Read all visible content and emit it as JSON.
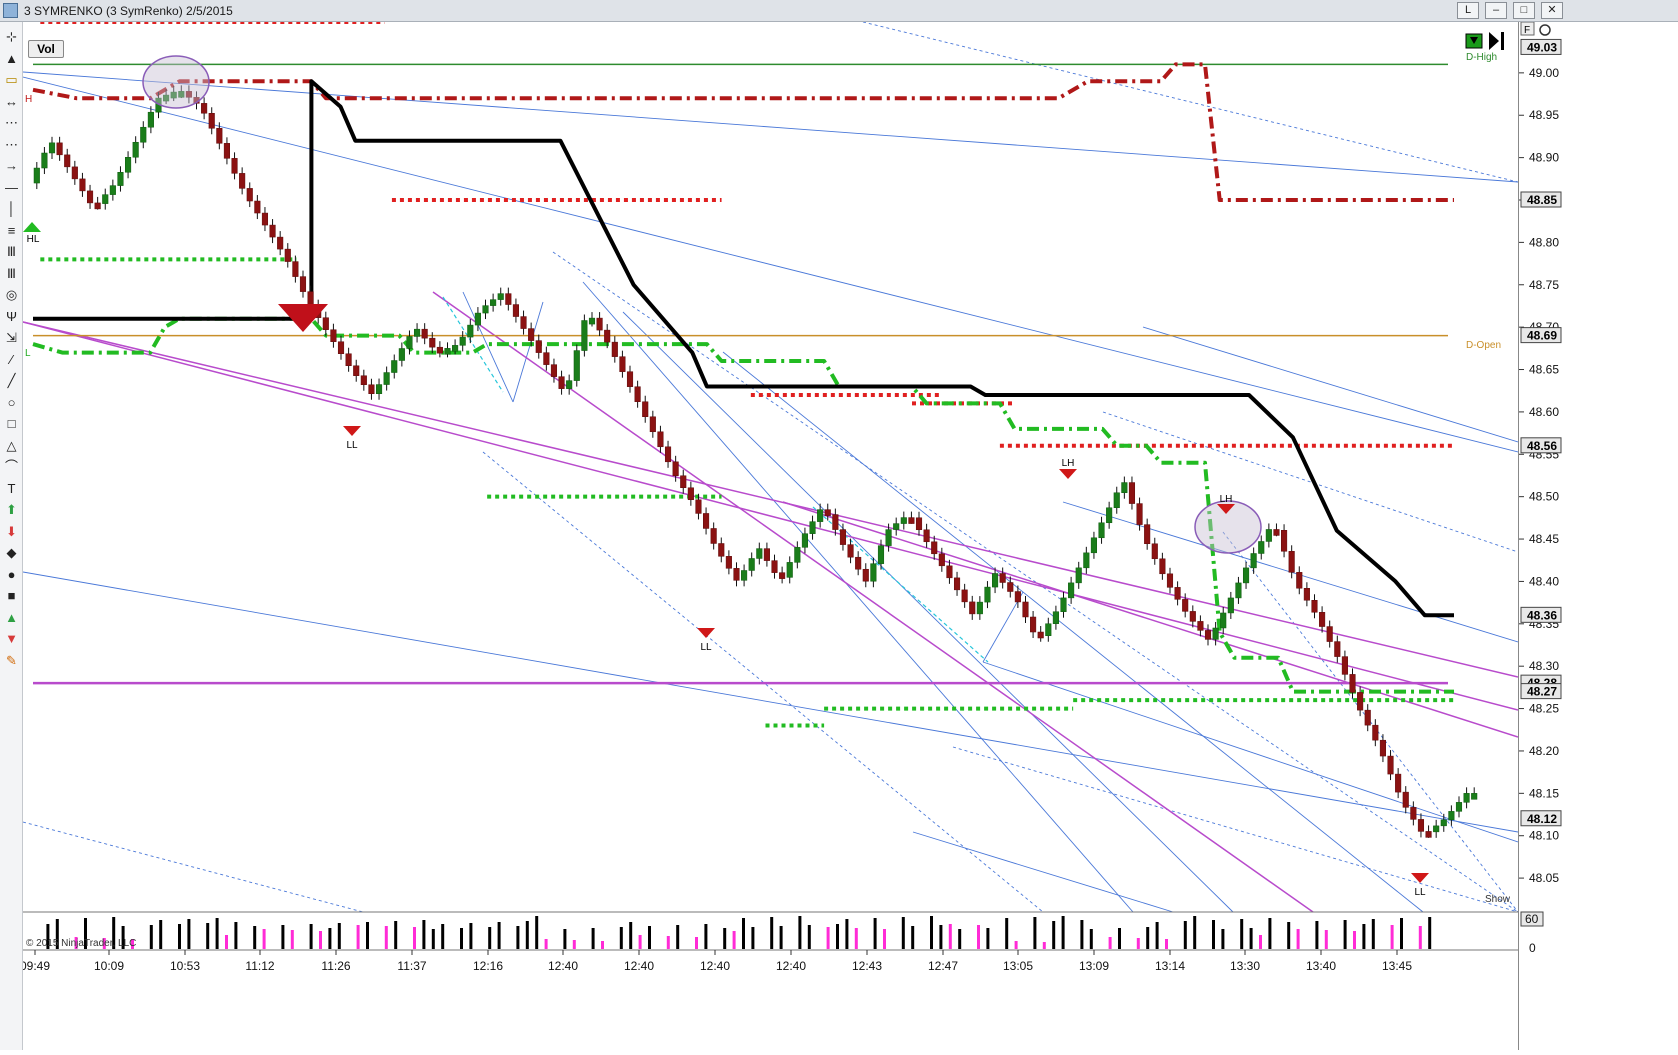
{
  "window": {
    "title": "3 SYMRENKO (3 SymRenko)  2/5/2015",
    "buttons": [
      "L",
      "–",
      "□",
      "✕"
    ],
    "accent": "#dfe3e8"
  },
  "indicator_tag": "Vol",
  "markers": {
    "d_high": "D-High",
    "d_open": "D-Open",
    "show": "Show",
    "hl": "HL",
    "h": "H",
    "l": "L",
    "ll1": "LL",
    "ll2": "LL",
    "ll3": "LL",
    "lh1": "LH",
    "lh2": "LH",
    "copyright": "© 2015 NinjaTrader, LLC"
  },
  "price_tags": [
    {
      "label": "49.03",
      "color": "#ffffff",
      "text": "#000000"
    },
    {
      "label": "48.85",
      "color": "#ffffff",
      "text": "#000000"
    },
    {
      "label": "48.69",
      "color": "#ffffff",
      "text": "#000000"
    },
    {
      "label": "48.56",
      "color": "#ffffff",
      "text": "#000000"
    },
    {
      "label": "48.36",
      "color": "#ffffff",
      "text": "#000000"
    },
    {
      "label": "48.28",
      "color": "#ffffff",
      "text": "#000000"
    },
    {
      "label": "48.27",
      "color": "#ffffff",
      "text": "#000000"
    },
    {
      "label": "48.12",
      "color": "#ffffff",
      "text": "#000000"
    }
  ],
  "volume_axis": {
    "ticks": [
      "60",
      "0"
    ]
  },
  "toolbar_icons": [
    "crosshair-icon",
    "arrow-up-icon",
    "rect-icon",
    "arrow-line-icon",
    "dots-line-icon",
    "dots-line2-icon",
    "arrow-right-icon",
    "hline-icon",
    "vline-icon",
    "channel-icon",
    "fib-icon",
    "fib2-icon",
    "target-icon",
    "pitchfork-icon",
    "regression-icon",
    "ray-icon",
    "line-icon",
    "circle-icon",
    "square-icon",
    "triangle-icon",
    "arc-icon",
    "text-icon",
    "up-arrow-icon",
    "down-arrow-icon",
    "diamond-icon",
    "dot-icon",
    "stop-icon",
    "triangle-up-icon",
    "triangle-down-icon",
    "pencil-icon"
  ],
  "chart_data": {
    "type": "candlestick",
    "title": "3 SYMRENKO (3 SymRenko)  2/5/2015",
    "y_range": [
      48.01,
      49.06
    ],
    "y_ticks": [
      49.0,
      48.95,
      48.9,
      48.85,
      48.8,
      48.75,
      48.7,
      48.65,
      48.6,
      48.55,
      48.5,
      48.45,
      48.4,
      48.35,
      48.3,
      48.25,
      48.2,
      48.15,
      48.1,
      48.05
    ],
    "x_tick_labels": [
      "09:49",
      "10:09",
      "10:53",
      "11:12",
      "11:26",
      "11:37",
      "12:16",
      "12:40",
      "12:40",
      "12:40",
      "12:40",
      "12:43",
      "12:47",
      "13:05",
      "13:09",
      "13:14",
      "13:30",
      "13:40",
      "13:45"
    ],
    "price_path": [
      48.87,
      48.92,
      48.88,
      48.84,
      48.87,
      48.92,
      48.97,
      48.98,
      48.96,
      48.91,
      48.86,
      48.82,
      48.78,
      48.73,
      48.69,
      48.65,
      48.62,
      48.66,
      48.7,
      48.67,
      48.68,
      48.72,
      48.74,
      48.7,
      48.66,
      48.62,
      48.72,
      48.68,
      48.63,
      48.58,
      48.53,
      48.49,
      48.44,
      48.4,
      48.44,
      48.4,
      48.45,
      48.49,
      48.44,
      48.4,
      48.46,
      48.48,
      48.44,
      48.4,
      48.36,
      48.41,
      48.38,
      48.33,
      48.37,
      48.42,
      48.47,
      48.52,
      48.45,
      48.4,
      48.36,
      48.33,
      48.38,
      48.43,
      48.47,
      48.4,
      48.36,
      48.31,
      48.25,
      48.2,
      48.14,
      48.1,
      48.12,
      48.15
    ],
    "volume_bars_magenta_fraction": 0.3,
    "series": [
      {
        "name": "",
        "type": "hline",
        "value": 49.01,
        "color": "#2e8b2e"
      },
      {
        "name": "",
        "type": "hline",
        "value": 48.69,
        "color": "#c98f2a"
      },
      {
        "name": "",
        "type": "hline",
        "value": 48.28,
        "color": "#b84bcc"
      }
    ],
    "stop_line_black": [
      [
        0.0,
        48.71
      ],
      [
        0.19,
        48.71
      ],
      [
        0.19,
        48.99
      ],
      [
        0.21,
        48.96
      ],
      [
        0.22,
        48.92
      ],
      [
        0.36,
        48.92
      ],
      [
        0.41,
        48.75
      ],
      [
        0.45,
        48.67
      ],
      [
        0.46,
        48.63
      ],
      [
        0.64,
        48.63
      ],
      [
        0.65,
        48.62
      ],
      [
        0.83,
        48.62
      ],
      [
        0.86,
        48.57
      ],
      [
        0.89,
        48.46
      ],
      [
        0.93,
        48.4
      ],
      [
        0.95,
        48.36
      ],
      [
        0.97,
        48.36
      ]
    ],
    "stop_line_darkred": [
      [
        0.0,
        48.98
      ],
      [
        0.03,
        48.97
      ],
      [
        0.08,
        48.97
      ],
      [
        0.1,
        48.99
      ],
      [
        0.19,
        48.99
      ],
      [
        0.2,
        48.97
      ],
      [
        0.7,
        48.97
      ],
      [
        0.72,
        48.99
      ],
      [
        0.77,
        48.99
      ],
      [
        0.78,
        49.01
      ],
      [
        0.8,
        49.01
      ],
      [
        0.81,
        48.85
      ],
      [
        0.97,
        48.85
      ]
    ],
    "stop_line_green": [
      [
        0.0,
        48.68
      ],
      [
        0.02,
        48.67
      ],
      [
        0.08,
        48.67
      ],
      [
        0.09,
        48.7
      ],
      [
        0.1,
        48.71
      ],
      [
        0.19,
        48.71
      ],
      [
        0.2,
        48.69
      ],
      [
        0.25,
        48.69
      ],
      [
        0.26,
        48.67
      ],
      [
        0.3,
        48.67
      ],
      [
        0.31,
        48.68
      ],
      [
        0.46,
        48.68
      ],
      [
        0.47,
        48.66
      ],
      [
        0.54,
        48.66
      ],
      [
        0.55,
        48.63
      ],
      [
        0.6,
        48.63
      ],
      [
        0.61,
        48.61
      ],
      [
        0.66,
        48.61
      ],
      [
        0.67,
        48.58
      ],
      [
        0.73,
        48.58
      ],
      [
        0.74,
        48.56
      ],
      [
        0.76,
        48.56
      ],
      [
        0.77,
        48.54
      ],
      [
        0.8,
        48.54
      ],
      [
        0.81,
        48.34
      ],
      [
        0.82,
        48.31
      ],
      [
        0.85,
        48.31
      ],
      [
        0.86,
        48.27
      ],
      [
        0.97,
        48.27
      ]
    ]
  }
}
